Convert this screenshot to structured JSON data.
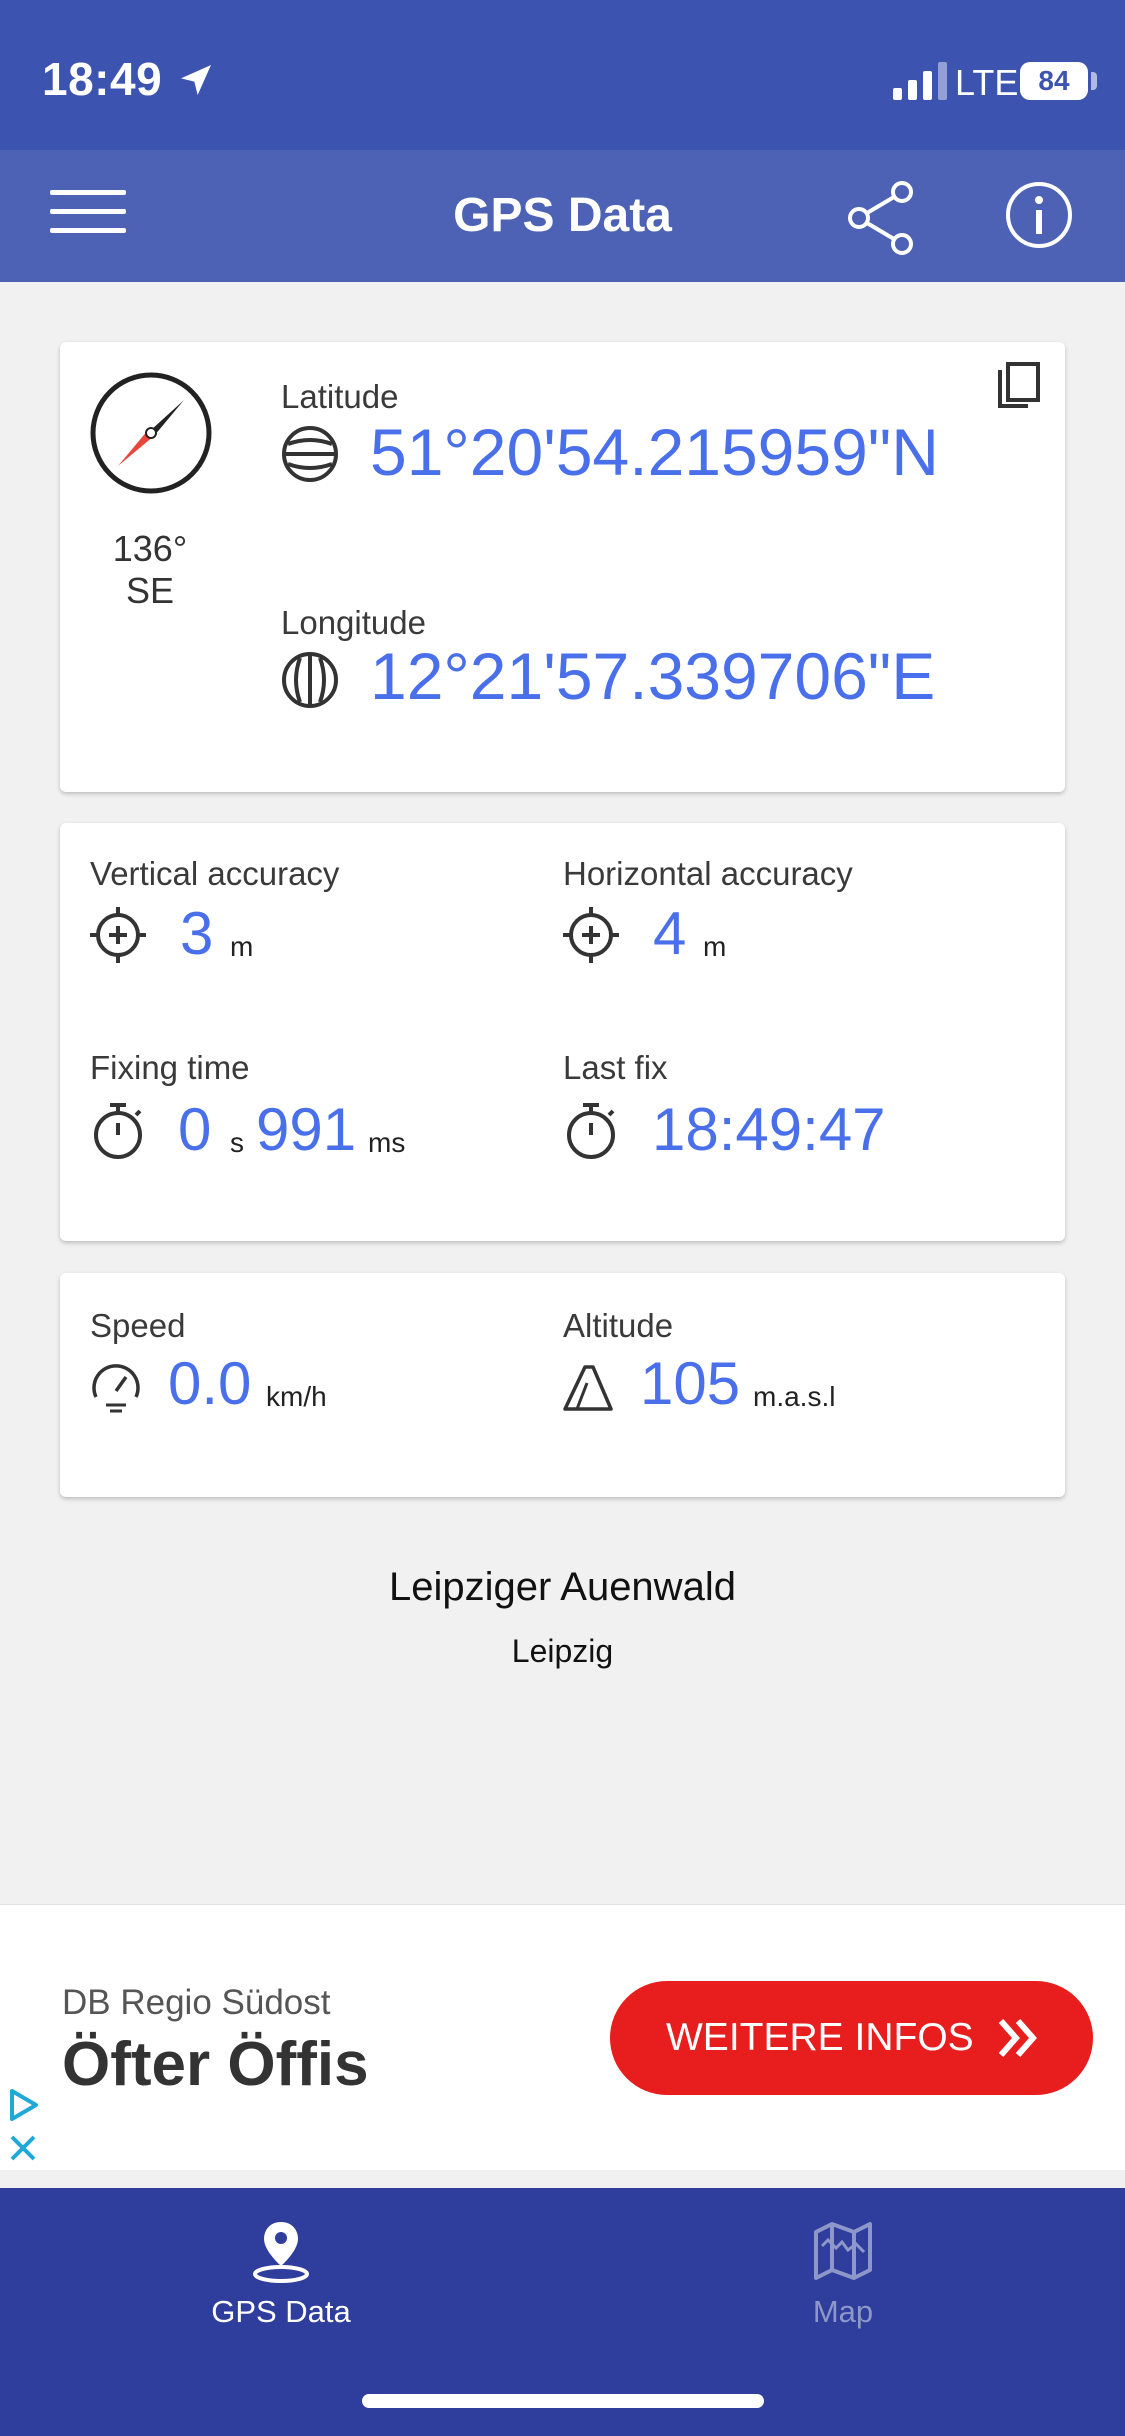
{
  "status_bar": {
    "time": "18:49",
    "network": "LTE",
    "battery": "84"
  },
  "app_bar": {
    "title": "GPS Data"
  },
  "heading": {
    "degrees": "136°",
    "direction": "SE"
  },
  "coordinates": {
    "latitude_label": "Latitude",
    "latitude_value": "51°20'54.215959\"N",
    "longitude_label": "Longitude",
    "longitude_value": "12°21'57.339706\"E"
  },
  "accuracy": {
    "vertical_label": "Vertical accuracy",
    "vertical_value": "3",
    "vertical_unit": "m",
    "horizontal_label": "Horizontal accuracy",
    "horizontal_value": "4",
    "horizontal_unit": "m",
    "fixing_label": "Fixing time",
    "fixing_seconds": "0",
    "fixing_seconds_unit": "s",
    "fixing_ms": "991",
    "fixing_ms_unit": "ms",
    "last_fix_label": "Last fix",
    "last_fix_value": "18:49:47"
  },
  "motion": {
    "speed_label": "Speed",
    "speed_value": "0.0",
    "speed_unit": "km/h",
    "altitude_label": "Altitude",
    "altitude_value": "105",
    "altitude_unit": "m.a.s.l"
  },
  "location": {
    "place": "Leipziger Auenwald",
    "city": "Leipzig"
  },
  "ad": {
    "sponsor": "DB Regio Südost",
    "headline": "Öfter Öffis",
    "cta": "WEITERE INFOS"
  },
  "bottom_nav": {
    "items": [
      {
        "label": "GPS Data",
        "icon": "location-pin-icon",
        "active": true
      },
      {
        "label": "Map",
        "icon": "map-icon",
        "active": false
      }
    ]
  },
  "colors": {
    "primary": "#3c53b0",
    "app_bar": "#4d62b4",
    "nav": "#2f3d9c",
    "value_blue": "#4a6fea",
    "ad_red": "#e81d1d",
    "compass_red": "#e8453c"
  }
}
